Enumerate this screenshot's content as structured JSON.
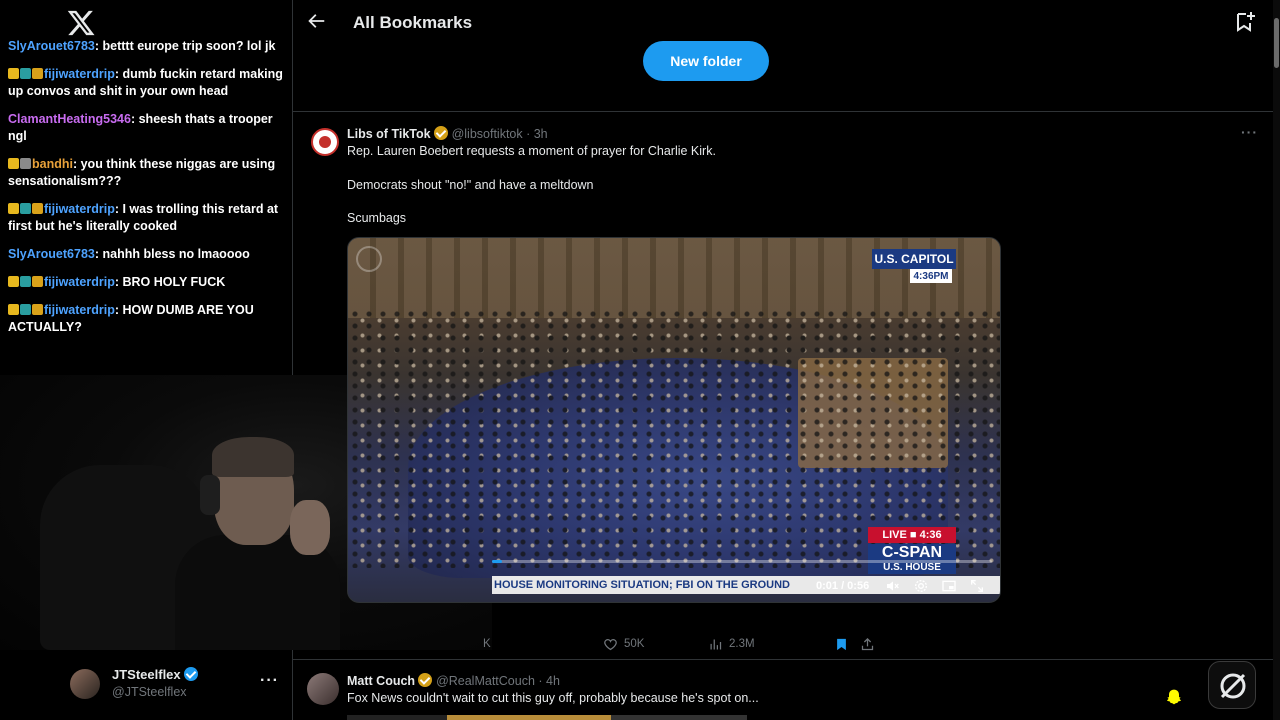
{
  "sidebar": {
    "logo_icon": "x-logo-icon",
    "chat": [
      {
        "user": "SlyArouet6783",
        "user_color": "#4ea3ff",
        "badges": [],
        "text": ": betttt europe trip soon? lol jk"
      },
      {
        "user": "fijiwaterdrip",
        "user_color": "#4ea3ff",
        "badges": [
          "crown",
          "teal",
          "gold"
        ],
        "text": ": dumb fuckin retard making up convos and shit in your own head"
      },
      {
        "user": "ClamantHeating5346",
        "user_color": "#c86cf0",
        "badges": [],
        "text": ": sheesh thats a trooper ngl"
      },
      {
        "user": "bandhi",
        "user_color": "#e8a13a",
        "badges": [
          "crown",
          "grey"
        ],
        "text": ": you think these niggas are using sensationalism???"
      },
      {
        "user": "fijiwaterdrip",
        "user_color": "#4ea3ff",
        "badges": [
          "crown",
          "teal",
          "gold"
        ],
        "text": ": I was trolling this retard at first but he's literally cooked"
      },
      {
        "user": "SlyArouet6783",
        "user_color": "#4ea3ff",
        "badges": [],
        "text": ": nahhh bless no lmaoooo"
      },
      {
        "user": "fijiwaterdrip",
        "user_color": "#4ea3ff",
        "badges": [
          "crown",
          "teal",
          "gold"
        ],
        "text": ": BRO HOLY FUCK"
      },
      {
        "user": "fijiwaterdrip",
        "user_color": "#4ea3ff",
        "badges": [
          "crown",
          "teal",
          "gold"
        ],
        "text": ": HOW DUMB ARE YOU ACTUALLY?"
      }
    ],
    "account": {
      "name": "JTSteelflex",
      "handle": "@JTSteelflex",
      "more": "···"
    }
  },
  "header": {
    "title": "All Bookmarks",
    "new_folder": "New folder"
  },
  "tweet1": {
    "name": "Libs of TikTok",
    "handle": "@libsoftiktok · 3h",
    "more": "···",
    "line1": "Rep. Lauren Boebert requests a moment of prayer for Charlie Kirk.",
    "line2": "Democrats shout \"no!\" and have a meltdown",
    "line3": "Scumbags",
    "video": {
      "capitol_label": "U.S. CAPITOL",
      "capitol_time": "4:36PM",
      "live_label": "LIVE ■ 4:36",
      "cspan": "C-SPAN",
      "cspan_sub": "U.S. HOUSE",
      "ticker": "HOUSE MONITORING SITUATION; FBI ON THE GROUND",
      "time": "0:01 / 0:56",
      "progress": 0.02
    },
    "stats": {
      "replies": "K",
      "likes": "50K",
      "views": "2.3M"
    }
  },
  "tweet2": {
    "name": "Matt Couch",
    "handle": "@RealMattCouch · 4h",
    "line1": "Fox News couldn't wait to cut this guy off, probably because he's spot on..."
  },
  "colors": {
    "accent": "#1d9bf0",
    "bookmark_active": "#1d9bf0",
    "cspan_blue": "#1b3a82",
    "live_red": "#c8102e"
  }
}
